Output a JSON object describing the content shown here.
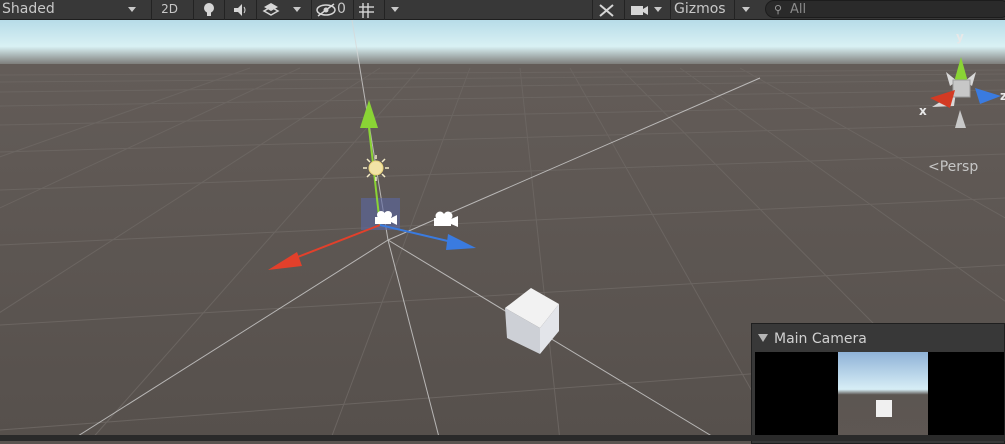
{
  "toolbar": {
    "shading_mode": "Shaded",
    "mode_2d_label": "2D",
    "hidden_objects_count": "0",
    "gizmos_label": "Gizmos",
    "search_placeholder": "All"
  },
  "viewport": {
    "projection_label": "Persp",
    "axis_labels": {
      "x": "x",
      "y": "y",
      "z": "z"
    }
  },
  "camera_preview": {
    "title": "Main Camera"
  },
  "colors": {
    "toolbar_bg": "#383838",
    "ground": "#5a5450",
    "sky_horizon": "#d8f0f4",
    "axis_x": "#e2402b",
    "axis_y": "#86d42c",
    "axis_z": "#3a7be0"
  }
}
